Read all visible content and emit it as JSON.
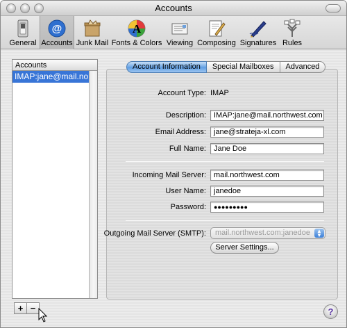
{
  "window": {
    "title": "Accounts"
  },
  "toolbar": {
    "items": [
      {
        "label": "General",
        "icon": "switch-icon"
      },
      {
        "label": "Accounts",
        "icon": "at-sign-icon",
        "selected": true
      },
      {
        "label": "Junk Mail",
        "icon": "junk-mail-icon"
      },
      {
        "label": "Fonts & Colors",
        "icon": "fonts-colors-icon"
      },
      {
        "label": "Viewing",
        "icon": "viewing-icon"
      },
      {
        "label": "Composing",
        "icon": "composing-icon"
      },
      {
        "label": "Signatures",
        "icon": "signatures-icon"
      },
      {
        "label": "Rules",
        "icon": "rules-icon"
      }
    ]
  },
  "accounts": {
    "header": "Accounts",
    "selected": "IMAP:jane@mail.no",
    "add_label": "+",
    "remove_label": "−"
  },
  "tabs": [
    {
      "label": "Account Information",
      "active": true
    },
    {
      "label": "Special Mailboxes",
      "active": false
    },
    {
      "label": "Advanced",
      "active": false
    }
  ],
  "form": {
    "account_type_label": "Account Type:",
    "account_type_value": "IMAP",
    "description_label": "Description:",
    "description_value": "IMAP:jane@mail.northwest.com",
    "email_label": "Email Address:",
    "email_value": "jane@strateja-xl.com",
    "fullname_label": "Full Name:",
    "fullname_value": "Jane Doe",
    "incoming_label": "Incoming Mail Server:",
    "incoming_value": "mail.northwest.com",
    "username_label": "User Name:",
    "username_value": "janedoe",
    "password_label": "Password:",
    "password_value": "●●●●●●●●●",
    "smtp_label": "Outgoing Mail Server (SMTP):",
    "smtp_value": "mail.northwest.com:janedoe",
    "server_settings_label": "Server Settings..."
  },
  "help": {
    "label": "?"
  },
  "colors": {
    "accent": "#3875d7",
    "tab_active": "#5b9be2"
  }
}
